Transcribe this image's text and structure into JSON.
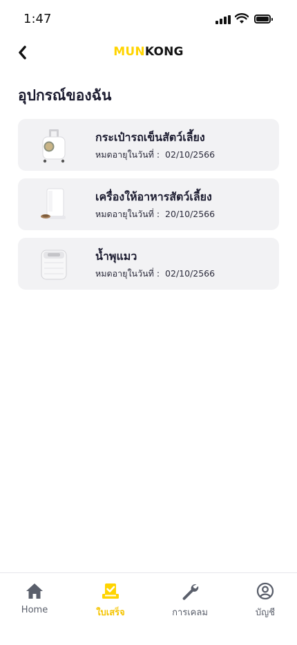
{
  "status_bar": {
    "time": "1:47"
  },
  "header": {
    "logo_part1": "MUN",
    "logo_part2": "KONG",
    "accent_color": "#ffd400"
  },
  "page": {
    "title": "อุปกรณ์ของฉัน"
  },
  "devices": [
    {
      "name": "กระเป๋ารถเข็นสัตว์เลี้ยง",
      "expiry_label": "หมดอายุในวันที่ :",
      "expiry_date": "02/10/2566",
      "icon": "pet-stroller-bag-image"
    },
    {
      "name": "เครื่องให้อาหารสัตว์เลี้ยง",
      "expiry_label": "หมดอายุในวันที่ :",
      "expiry_date": "20/10/2566",
      "icon": "pet-feeder-image"
    },
    {
      "name": "น้ำพุแมว",
      "expiry_label": "หมดอายุในวันที่ :",
      "expiry_date": "02/10/2566",
      "icon": "cat-fountain-image"
    }
  ],
  "bottom_nav": [
    {
      "label": "Home",
      "icon": "home-icon",
      "active": false
    },
    {
      "label": "ใบเสร็จ",
      "icon": "receipt-check-icon",
      "active": true
    },
    {
      "label": "การเคลม",
      "icon": "wrench-icon",
      "active": false
    },
    {
      "label": "บัญชี",
      "icon": "account-icon",
      "active": false
    }
  ]
}
